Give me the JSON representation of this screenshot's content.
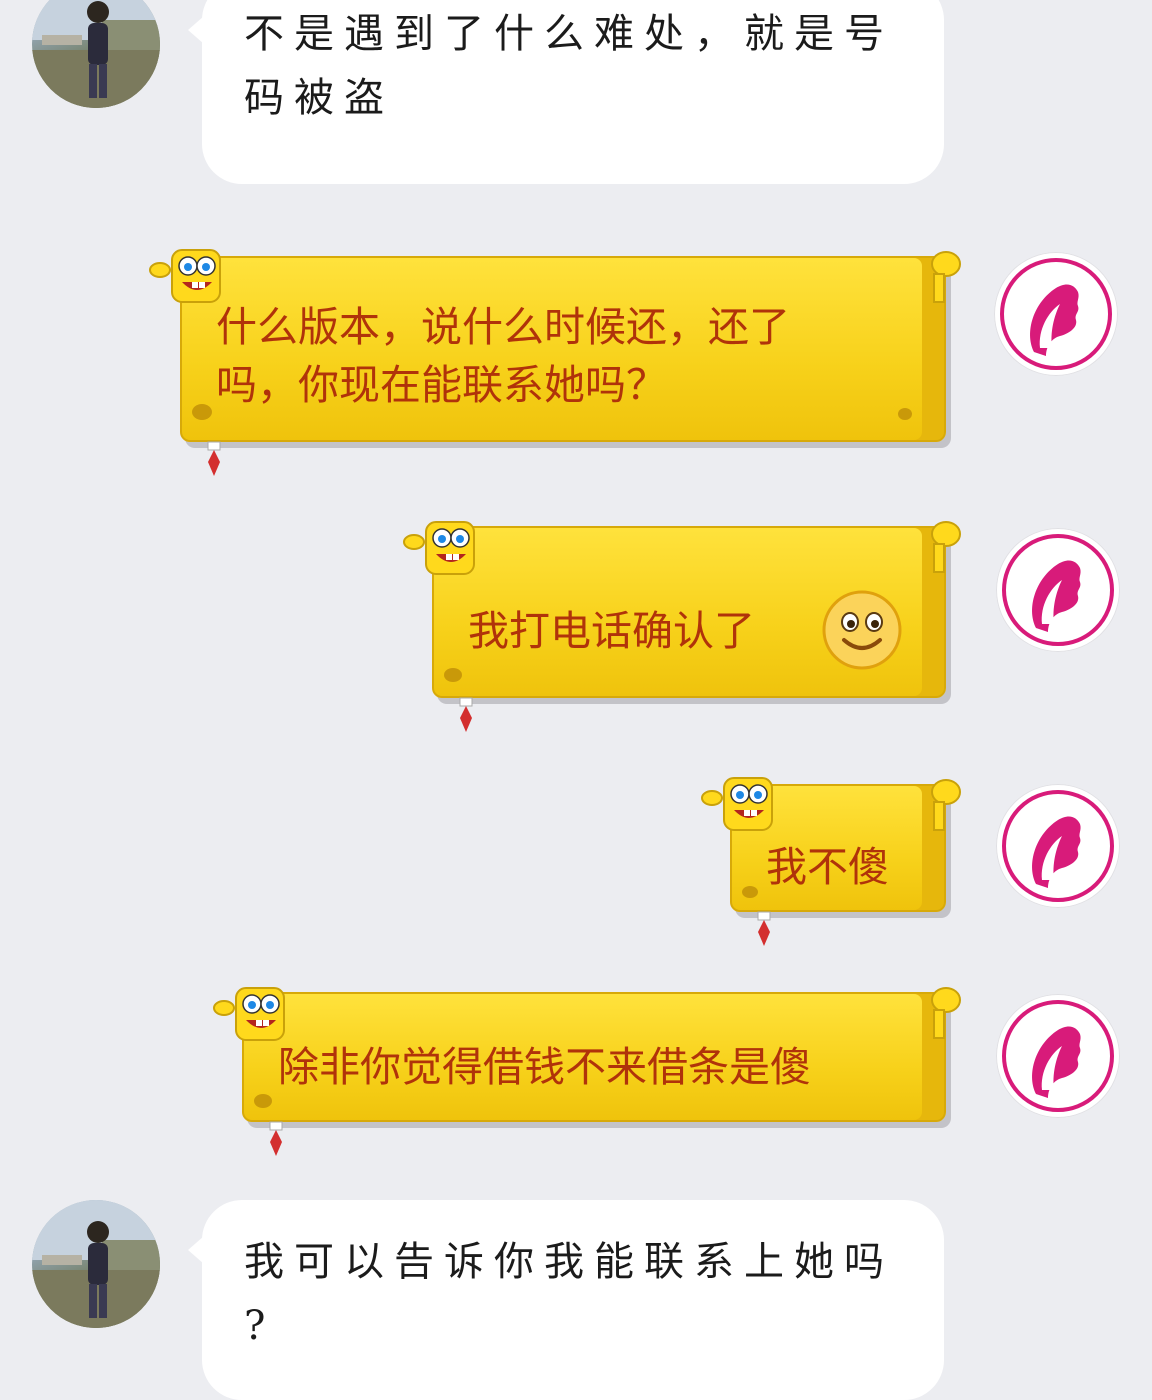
{
  "messages": [
    {
      "from": "contact",
      "lines": [
        "不是遇到了什么难处，就是号",
        "码被盗"
      ]
    },
    {
      "from": "self",
      "lines": [
        "什么版本，说什么时候还，还了",
        "吗，你现在能联系她吗？"
      ]
    },
    {
      "from": "self",
      "text": "我打电话确认了",
      "emoji": "smiley-emoji"
    },
    {
      "from": "self",
      "text": "我不傻"
    },
    {
      "from": "self",
      "text": "除非你觉得借钱不来借条是傻"
    },
    {
      "from": "contact",
      "lines": [
        "我可以告诉你我能联系上她吗",
        "?"
      ]
    }
  ],
  "colors": {
    "background": "#ecedf1",
    "incoming_bubble": "#ffffff",
    "outgoing_bubble": "#f7d11a",
    "outgoing_text": "#b0330a",
    "self_avatar_logo": "#d81b7a"
  },
  "icons": {
    "contact_avatar": "person-photo-avatar",
    "self_avatar": "pink-face-profile-logo",
    "bubble_decoration": "spongebob-thumbs-up-sticker"
  }
}
